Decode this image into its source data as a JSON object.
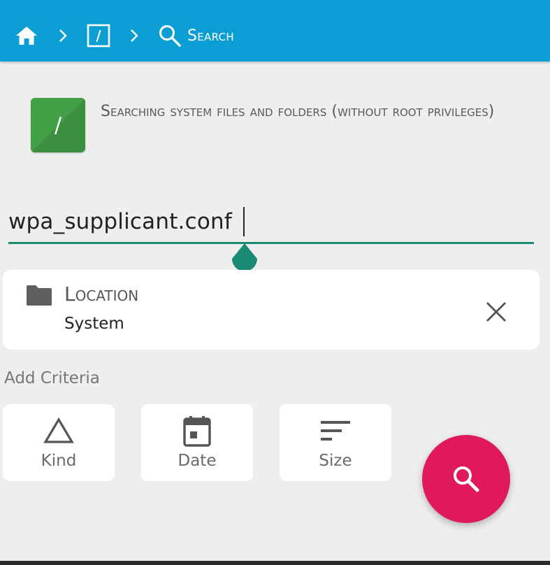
{
  "breadcrumb": {
    "home_icon": "home-icon",
    "root_label": "/",
    "search_label": "Search"
  },
  "header": {
    "tile_label": "/",
    "description": "Searching system files and folders (without root privileges)"
  },
  "query": {
    "value": "wpa_supplicant.conf"
  },
  "location": {
    "title": "Location",
    "value": "System"
  },
  "criteria": {
    "heading": "Add Criteria",
    "items": [
      {
        "label": "Kind",
        "icon": "triangle-icon"
      },
      {
        "label": "Date",
        "icon": "calendar-icon"
      },
      {
        "label": "Size",
        "icon": "sort-lines-icon"
      }
    ]
  },
  "colors": {
    "appbar": "#0a9ed5",
    "accent": "#1a8a75",
    "fab": "#e0185e",
    "tile": "#43a047"
  }
}
